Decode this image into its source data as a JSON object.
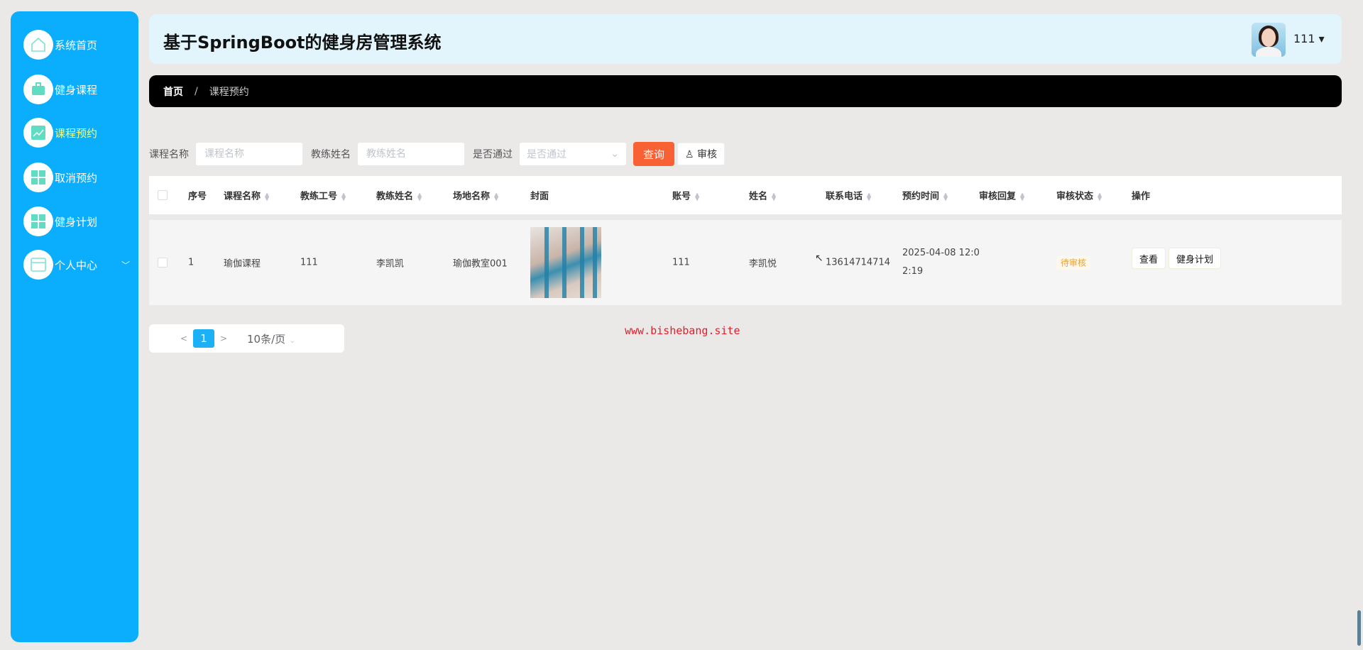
{
  "sidebar": {
    "items": [
      {
        "label": "系统首页",
        "icon": "home-icon"
      },
      {
        "label": "健身课程",
        "icon": "briefcase-icon"
      },
      {
        "label": "课程预约",
        "icon": "chart-icon",
        "active": true
      },
      {
        "label": "取消预约",
        "icon": "grid-icon"
      },
      {
        "label": "健身计划",
        "icon": "grid-icon"
      },
      {
        "label": "个人中心",
        "icon": "wallet-icon",
        "expand": "﹀"
      }
    ]
  },
  "header": {
    "title": "基于SpringBoot的健身房管理系统",
    "user": "111 ▾"
  },
  "breadcrumb": {
    "home": "首页",
    "sep": "/",
    "current": "课程预约"
  },
  "search": {
    "course_label": "课程名称",
    "course_placeholder": "课程名称",
    "coach_label": "教练姓名",
    "coach_placeholder": "教练姓名",
    "pass_label": "是否通过",
    "pass_placeholder": "是否通过",
    "query": "查询",
    "audit": "审核"
  },
  "table": {
    "headers": [
      "序号",
      "课程名称",
      "教练工号",
      "教练姓名",
      "场地名称",
      "封面",
      "账号",
      "姓名",
      "联系电话",
      "预约时间",
      "审核回复",
      "审核状态",
      "操作"
    ],
    "rows": [
      {
        "index": "1",
        "course": "瑜伽课程",
        "coach_id": "111",
        "coach_name": "李凯凯",
        "venue": "瑜伽教室001",
        "account": "111",
        "name": "李凯悦",
        "phone": "13614714714",
        "time1": "2025-04-08 12:0",
        "time2": "2:19",
        "reply": "",
        "status": "待审核",
        "view": "查看",
        "plan": "健身计划"
      }
    ]
  },
  "pagination": {
    "prev": "<",
    "page": "1",
    "next": ">",
    "size": "10条/页"
  },
  "watermark": "www.bishebang.site",
  "colors": {
    "sidebar": "#0aaefc",
    "accent": "#f86134",
    "page": "#1cb0f6"
  }
}
